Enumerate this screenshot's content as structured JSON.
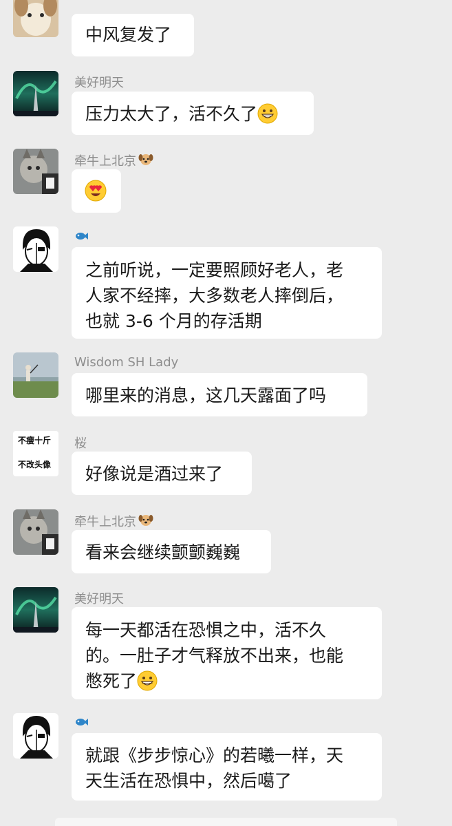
{
  "messages": [
    {
      "sender": "",
      "sender_emoji": "",
      "avatar": "dog-avatar",
      "lines": [
        "中风复发了"
      ],
      "trailing_emoji": ""
    },
    {
      "sender": "美好明天",
      "sender_emoji": "",
      "avatar": "aurora-avatar",
      "lines": [
        "压力太大了，活不久了"
      ],
      "trailing_emoji": "grinning-face"
    },
    {
      "sender": "牵牛上北京",
      "sender_emoji": "dog-face",
      "avatar": "cat-avatar",
      "lines": [],
      "trailing_emoji": "heart-eyes-face"
    },
    {
      "sender": "",
      "sender_emoji": "fish",
      "avatar": "mask-avatar",
      "lines": [
        "之前听说，一定要照顾好老人，老",
        "人家不经摔，大多数老人摔倒后，",
        "也就 3-6 个月的存活期"
      ],
      "trailing_emoji": ""
    },
    {
      "sender": "Wisdom SH Lady",
      "sender_emoji": "",
      "avatar": "golf-avatar",
      "lines": [
        "哪里来的消息，这几天露面了吗"
      ],
      "trailing_emoji": ""
    },
    {
      "sender": "桜",
      "sender_emoji": "",
      "avatar": "text-avatar",
      "avatar_text": [
        "不瘦十斤",
        "不改头像"
      ],
      "lines": [
        "好像说是酒过来了"
      ],
      "trailing_emoji": ""
    },
    {
      "sender": "牵牛上北京",
      "sender_emoji": "dog-face",
      "avatar": "cat-avatar",
      "lines": [
        "看来会继续颤颤巍巍"
      ],
      "trailing_emoji": ""
    },
    {
      "sender": "美好明天",
      "sender_emoji": "",
      "avatar": "aurora-avatar",
      "lines": [
        "每一天都活在恐惧之中，活不久",
        "的。一肚子才气释放不出来，也能",
        "憋死了"
      ],
      "trailing_emoji": "grinning-face"
    },
    {
      "sender": "",
      "sender_emoji": "fish",
      "avatar": "mask-avatar",
      "lines": [
        "就跟《步步惊心》的若曦一样，天",
        "天生活在恐惧中，然后噶了"
      ],
      "trailing_emoji": ""
    }
  ]
}
